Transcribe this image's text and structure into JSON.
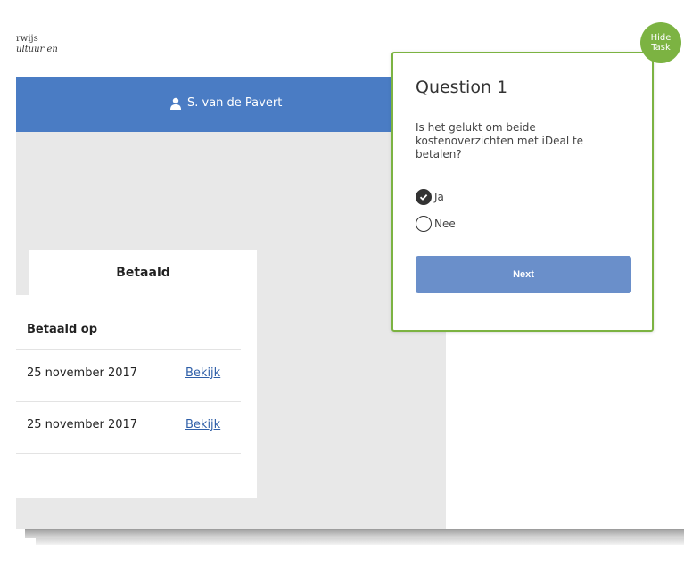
{
  "header": {
    "logo_line1": "rwijs",
    "logo_line2": "ultuur en",
    "user_icon": "person-icon",
    "user_name": "S. van de Pavert"
  },
  "table": {
    "tab_label": "Betaald",
    "column_header": "Betaald op",
    "rows": [
      {
        "date": "25 november 2017",
        "link": "Bekijk"
      },
      {
        "date": "25 november 2017",
        "link": "Bekijk"
      }
    ]
  },
  "task": {
    "title": "Question 1",
    "question": "Is het gelukt om beide kostenoverzichten met iDeal te betalen?",
    "options": [
      {
        "label": "Ja",
        "selected": true
      },
      {
        "label": "Nee",
        "selected": false
      }
    ],
    "next_label": "Next",
    "hide_line1": "Hide",
    "hide_line2": "Task"
  },
  "colors": {
    "topbar": "#4a7cc4",
    "accent_green": "#7cb342",
    "next_button": "#6a8fca",
    "link": "#2f5fa8"
  }
}
